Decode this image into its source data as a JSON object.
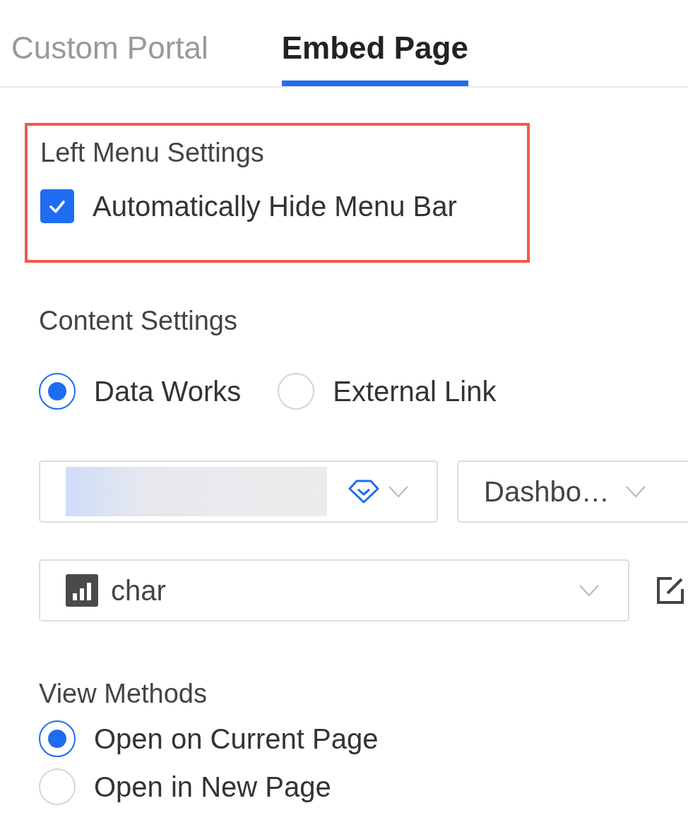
{
  "tabs": [
    {
      "label": "Custom Portal",
      "selected": false
    },
    {
      "label": "Embed Page",
      "selected": true
    }
  ],
  "left_menu_settings": {
    "title": "Left Menu Settings",
    "highlighted": true,
    "checkbox": {
      "label": "Automatically Hide Menu Bar",
      "checked": true
    }
  },
  "content_settings": {
    "title": "Content Settings",
    "source_options": [
      {
        "label": "Data Works",
        "selected": true
      },
      {
        "label": "External Link",
        "selected": false
      }
    ],
    "type_select": {
      "value": "Dashbo…"
    },
    "item_select": {
      "value": "char"
    }
  },
  "view_methods": {
    "title": "View Methods",
    "options": [
      {
        "label": "Open on Current Page",
        "selected": true
      },
      {
        "label": "Open in New Page",
        "selected": false
      }
    ]
  }
}
